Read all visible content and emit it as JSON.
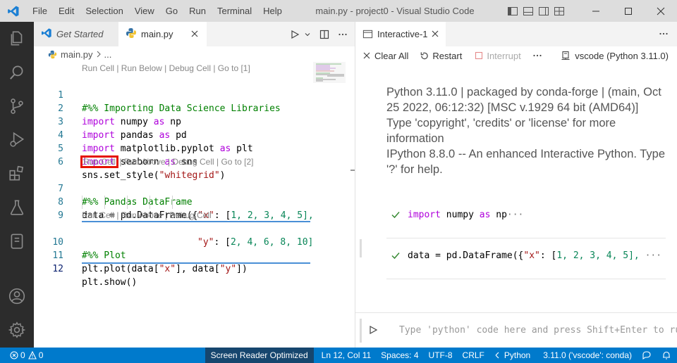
{
  "menu": [
    "File",
    "Edit",
    "Selection",
    "View",
    "Go",
    "Run",
    "Terminal",
    "Help"
  ],
  "window_title": "main.py - project0 - Visual Studio Code",
  "editor": {
    "tabs": [
      {
        "label": "Get Started",
        "icon": "vscode-logo-icon",
        "active": false
      },
      {
        "label": "main.py",
        "icon": "python-file-icon",
        "active": true
      }
    ],
    "breadcrumb": {
      "file": "main.py",
      "rest": "..."
    },
    "codelens": [
      "Run Cell | Run Below | Debug Cell | Go to [1]",
      {
        "run_cell": "Run Cell",
        "rest": " | Run Above | Debug Cell | Go to [2]"
      },
      "Run Cell | Run Above | Debug Cell"
    ],
    "lines": [
      {
        "n": "1",
        "text": "#%% Importing Data Science Libraries"
      },
      {
        "n": "2",
        "kw1": "import",
        "mod": " numpy ",
        "kw2": "as",
        "alias": " np"
      },
      {
        "n": "3",
        "kw1": "import",
        "mod": " pandas ",
        "kw2": "as",
        "alias": " pd"
      },
      {
        "n": "4",
        "kw1": "import",
        "mod": " matplotlib.pyplot ",
        "kw2": "as",
        "alias": " plt"
      },
      {
        "n": "5",
        "kw1": "import",
        "mod": " seaborn ",
        "kw2": "as",
        "alias": " sns"
      },
      {
        "n": "6",
        "pre": "sns.set_style(",
        "str": "\"whitegrid\"",
        "post": ")"
      },
      {
        "n": "7",
        "text": "#%% Pandas DataFrame"
      },
      {
        "n": "8",
        "pre": "data = pd.DataFrame({",
        "str": "\"x\"",
        "mid": ": [",
        "nums": "1, 2, 3, 4, 5],"
      },
      {
        "n": "9",
        "str": "\"y\"",
        "mid": ": [",
        "nums": "2, 4, 6, 8, 10]"
      },
      {
        "n": "10",
        "text": "#%% Plot"
      },
      {
        "n": "11",
        "pre": "plt.plot(data[",
        "str1": "\"x\"",
        "mid": "], data[",
        "str2": "\"y\"",
        "post": "])"
      },
      {
        "n": "12",
        "text": "plt.show()"
      }
    ]
  },
  "interactive": {
    "tab_label": "Interactive-1",
    "toolbar": {
      "clear_all": "Clear All",
      "restart": "Restart",
      "interrupt": "Interrupt",
      "kernel": "vscode (Python 3.11.0)"
    },
    "banner": [
      "Python 3.11.0 | packaged by conda-forge | (main, Oct",
      "25 2022, 06:12:32) [MSC v.1929 64 bit (AMD64)]",
      "Type 'copyright', 'credits' or 'license' for more",
      "information",
      "IPython 8.8.0 -- An enhanced Interactive Python. Type",
      "'?' for help."
    ],
    "cells": [
      {
        "kw": "import",
        "rest": " numpy ",
        "kw2": "as",
        "rest2": " np",
        "ellipsis": "···"
      },
      {
        "pre": "data = pd.DataFrame({",
        "str": "\"x\"",
        "mid": ": [",
        "nums": "1, 2, 3, 4, 5],",
        "ellipsis": "···"
      }
    ],
    "input_placeholder": "Type 'python' code here and press Shift+Enter to run"
  },
  "status": {
    "errors": "0",
    "warnings": "0",
    "screen_reader": "Screen Reader Optimized",
    "position": "Ln 12, Col 11",
    "spaces": "Spaces: 4",
    "encoding": "UTF-8",
    "eol": "CRLF",
    "language": "Python",
    "interpreter": "3.11.0 ('vscode': conda)"
  },
  "colors": {
    "accent": "#007acc",
    "highlight_box": "#e51400",
    "activity_bar": "#2c2c2c"
  }
}
